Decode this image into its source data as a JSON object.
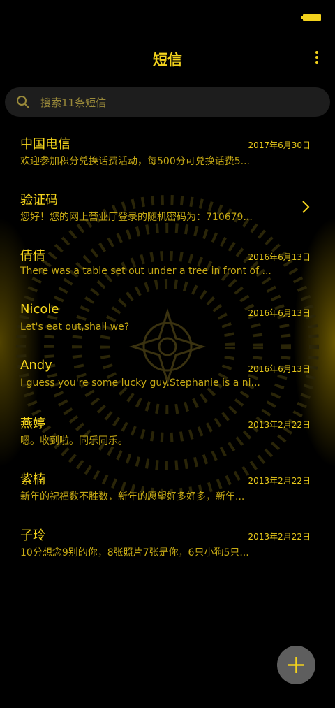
{
  "status_bar": {
    "battery_icon": "battery-icon"
  },
  "header": {
    "title": "短信",
    "more_icon": "more-vertical-icon"
  },
  "search": {
    "placeholder": "搜索11条短信",
    "icon": "search-icon"
  },
  "conversations": [
    {
      "name": "中国电信",
      "date": "2017年6月30日",
      "preview": "欢迎参加积分兑换话费活动，每500分可兑换话费5..."
    },
    {
      "name": "验证码",
      "date": "",
      "preview": "您好！您的网上营业厅登录的随机密码为：710679...",
      "has_chevron": true
    },
    {
      "name": "倩倩",
      "date": "2016年6月13日",
      "preview": "There was a table set out under a tree in front of ..."
    },
    {
      "name": "Nicole",
      "date": "2016年6月13日",
      "preview": "Let's eat out,shall we?"
    },
    {
      "name": "Andy",
      "date": "2016年6月13日",
      "preview": "I guess you're some lucky guy.Stephanie is a ni..."
    },
    {
      "name": "燕婷",
      "date": "2013年2月22日",
      "preview": "嗯。收到啦。同乐同乐。"
    },
    {
      "name": "紫楠",
      "date": "2013年2月22日",
      "preview": "新年的祝福数不胜数，新年的愿望好多好多，新年..."
    },
    {
      "name": "子玲",
      "date": "2013年2月22日",
      "preview": "10分想念9别的你，8张照片7张是你，6只小狗5只..."
    }
  ],
  "fab": {
    "icon": "plus-icon"
  },
  "colors": {
    "accent": "#f3d21c",
    "background": "#000000",
    "search_bg": "#1d1d1d",
    "fab_bg": "#5e5e5e"
  }
}
